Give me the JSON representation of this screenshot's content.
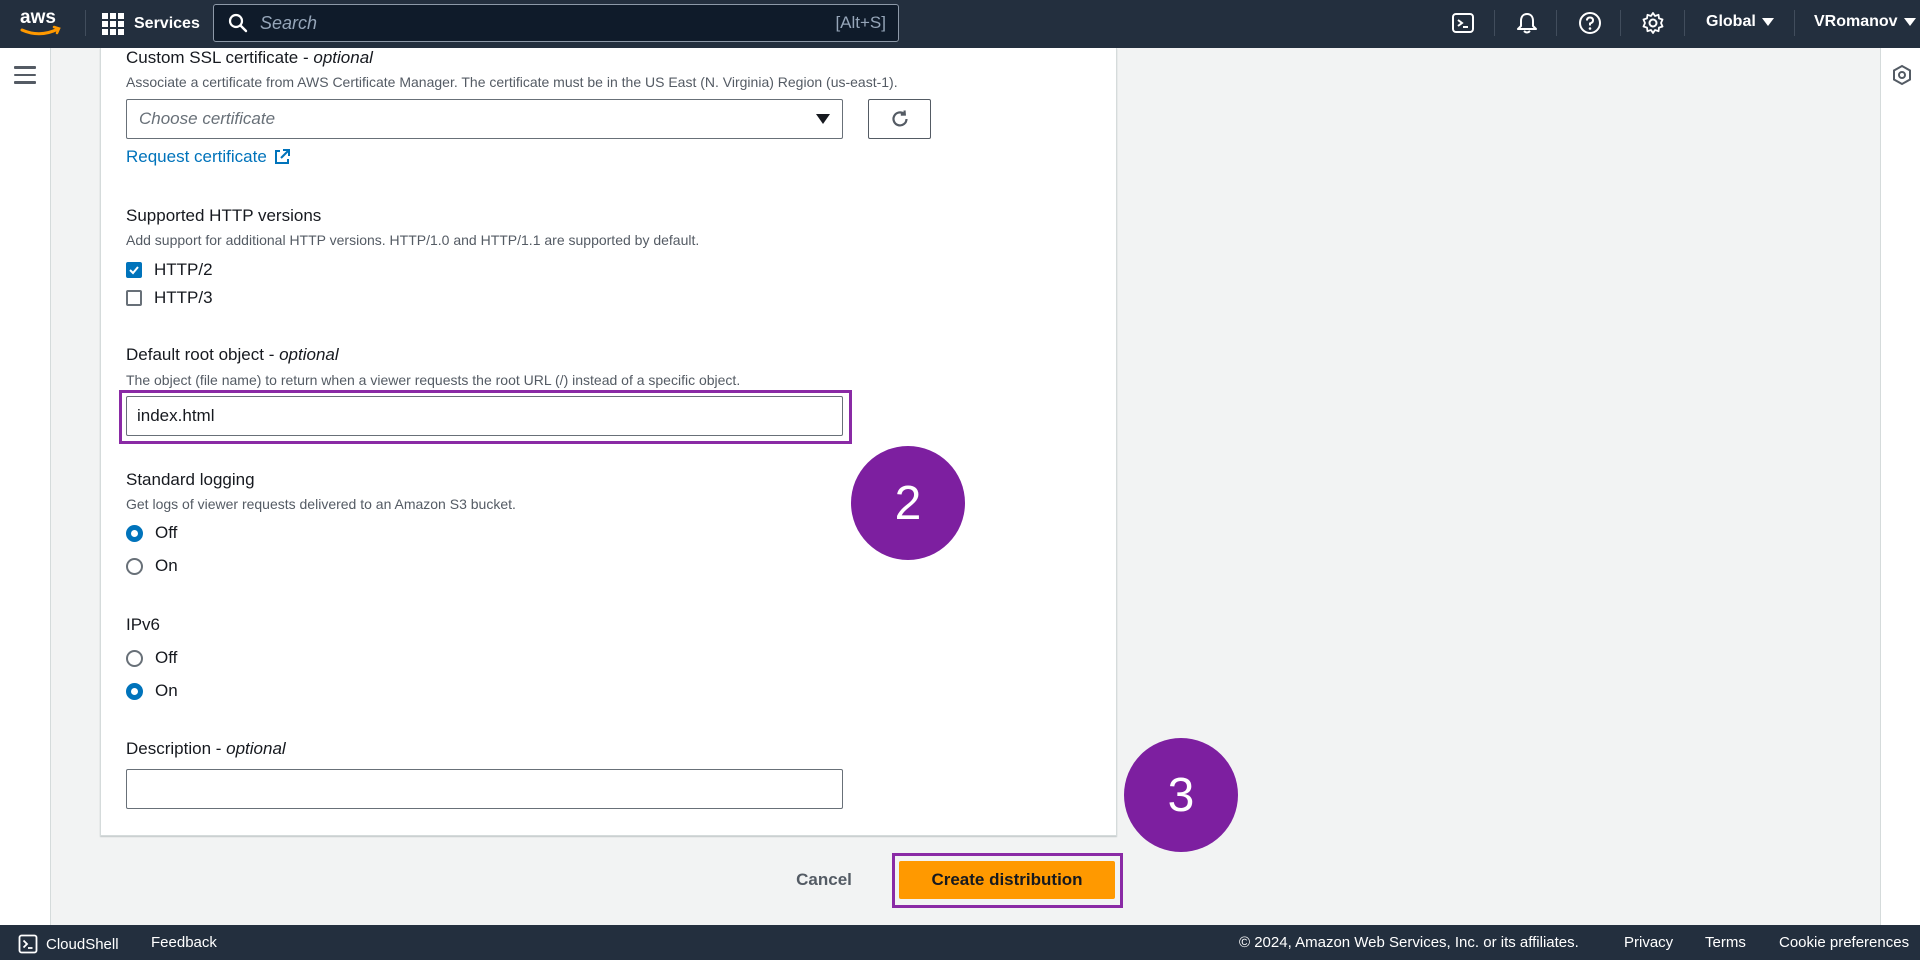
{
  "topnav": {
    "logo_icon": "aws-logo",
    "services_label": "Services",
    "search_placeholder": "Search",
    "search_shortcut": "[Alt+S]",
    "icons": [
      "cloudshell-icon",
      "notifications-bell-icon",
      "help-circle-icon",
      "settings-gear-icon"
    ],
    "region_label": "Global",
    "user_label": "VRomanov"
  },
  "form": {
    "ssl": {
      "label": "Custom SSL certificate - ",
      "optional": "optional",
      "description": "Associate a certificate from AWS Certificate Manager. The certificate must be in the US East (N. Virginia) Region (us-east-1).",
      "select_placeholder": "Choose certificate",
      "request_link": "Request certificate"
    },
    "http_versions": {
      "label": "Supported HTTP versions",
      "description": "Add support for additional HTTP versions. HTTP/1.0 and HTTP/1.1 are supported by default.",
      "options": [
        {
          "label": "HTTP/2",
          "checked": true
        },
        {
          "label": "HTTP/3",
          "checked": false
        }
      ]
    },
    "root_object": {
      "label": "Default root object - ",
      "optional": "optional",
      "description": "The object (file name) to return when a viewer requests the root URL (/) instead of a specific object.",
      "value": "index.html"
    },
    "logging": {
      "label": "Standard logging",
      "description": "Get logs of viewer requests delivered to an Amazon S3 bucket.",
      "options": [
        {
          "label": "Off",
          "selected": true
        },
        {
          "label": "On",
          "selected": false
        }
      ]
    },
    "ipv6": {
      "label": "IPv6",
      "options": [
        {
          "label": "Off",
          "selected": false
        },
        {
          "label": "On",
          "selected": true
        }
      ]
    },
    "description_field": {
      "label": "Description - ",
      "optional": "optional",
      "value": ""
    }
  },
  "actions": {
    "cancel_label": "Cancel",
    "create_label": "Create distribution"
  },
  "callouts": {
    "step2": "2",
    "step3": "3",
    "color": "#7d1fa0",
    "highlight_color": "#8a2aa5"
  },
  "footer": {
    "cloudshell_label": "CloudShell",
    "feedback_label": "Feedback",
    "copyright": "© 2024, Amazon Web Services, Inc. or its affiliates.",
    "privacy": "Privacy",
    "terms": "Terms",
    "cookies": "Cookie preferences"
  },
  "colors": {
    "nav_bg": "#232f3e",
    "link": "#0073bb",
    "primary_button": "#ff9900"
  }
}
